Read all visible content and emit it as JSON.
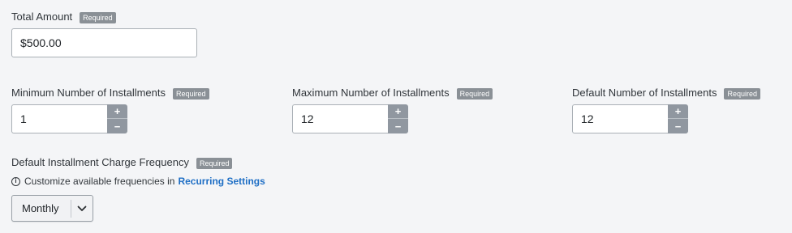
{
  "total_amount": {
    "label": "Total Amount",
    "badge": "Required",
    "value": "$500.00"
  },
  "min_installments": {
    "label": "Minimum Number of Installments",
    "badge": "Required",
    "value": "1",
    "increment": "+",
    "decrement": "−"
  },
  "max_installments": {
    "label": "Maximum Number of Installments",
    "badge": "Required",
    "value": "12",
    "increment": "+",
    "decrement": "−"
  },
  "default_installments": {
    "label": "Default Number of Installments",
    "badge": "Required",
    "value": "12",
    "increment": "+",
    "decrement": "−"
  },
  "frequency": {
    "label": "Default Installment Charge Frequency",
    "badge": "Required",
    "help_text": "Customize available frequencies in",
    "help_link": "Recurring Settings",
    "info_icon_glyph": "i",
    "selected": "Monthly"
  },
  "colors": {
    "badge_bg": "#8a9096",
    "link": "#1f6fc5",
    "stepper_btn": "#9097a0",
    "page_bg": "#f4f5f7"
  }
}
